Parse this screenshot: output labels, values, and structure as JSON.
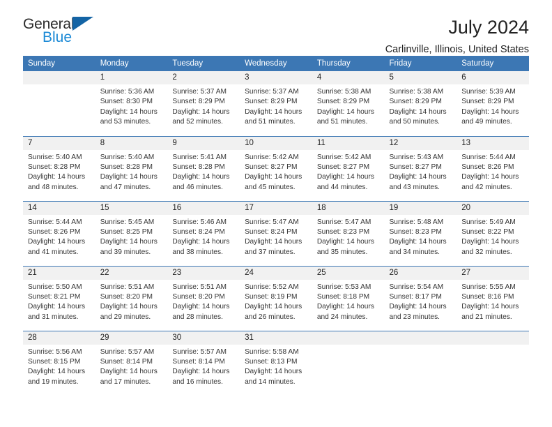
{
  "logo": {
    "word1": "General",
    "word2": "Blue",
    "triangle_color": "#1464a5",
    "blue_color": "#1c8ad6"
  },
  "header": {
    "month_title": "July 2024",
    "location": "Carlinville, Illinois, United States"
  },
  "colors": {
    "header_blue": "#3c77b4",
    "daynum_band": "#f1f1f1",
    "text": "#333333"
  },
  "calendar": {
    "weekday_headers": [
      "Sunday",
      "Monday",
      "Tuesday",
      "Wednesday",
      "Thursday",
      "Friday",
      "Saturday"
    ],
    "labels": {
      "sunrise": "Sunrise:",
      "sunset": "Sunset:",
      "daylight": "Daylight:"
    },
    "weeks": [
      [
        {
          "day": ""
        },
        {
          "day": "1",
          "sunrise": "Sunrise: 5:36 AM",
          "sunset": "Sunset: 8:30 PM",
          "daylight1": "Daylight: 14 hours",
          "daylight2": "and 53 minutes."
        },
        {
          "day": "2",
          "sunrise": "Sunrise: 5:37 AM",
          "sunset": "Sunset: 8:29 PM",
          "daylight1": "Daylight: 14 hours",
          "daylight2": "and 52 minutes."
        },
        {
          "day": "3",
          "sunrise": "Sunrise: 5:37 AM",
          "sunset": "Sunset: 8:29 PM",
          "daylight1": "Daylight: 14 hours",
          "daylight2": "and 51 minutes."
        },
        {
          "day": "4",
          "sunrise": "Sunrise: 5:38 AM",
          "sunset": "Sunset: 8:29 PM",
          "daylight1": "Daylight: 14 hours",
          "daylight2": "and 51 minutes."
        },
        {
          "day": "5",
          "sunrise": "Sunrise: 5:38 AM",
          "sunset": "Sunset: 8:29 PM",
          "daylight1": "Daylight: 14 hours",
          "daylight2": "and 50 minutes."
        },
        {
          "day": "6",
          "sunrise": "Sunrise: 5:39 AM",
          "sunset": "Sunset: 8:29 PM",
          "daylight1": "Daylight: 14 hours",
          "daylight2": "and 49 minutes."
        }
      ],
      [
        {
          "day": "7",
          "sunrise": "Sunrise: 5:40 AM",
          "sunset": "Sunset: 8:28 PM",
          "daylight1": "Daylight: 14 hours",
          "daylight2": "and 48 minutes."
        },
        {
          "day": "8",
          "sunrise": "Sunrise: 5:40 AM",
          "sunset": "Sunset: 8:28 PM",
          "daylight1": "Daylight: 14 hours",
          "daylight2": "and 47 minutes."
        },
        {
          "day": "9",
          "sunrise": "Sunrise: 5:41 AM",
          "sunset": "Sunset: 8:28 PM",
          "daylight1": "Daylight: 14 hours",
          "daylight2": "and 46 minutes."
        },
        {
          "day": "10",
          "sunrise": "Sunrise: 5:42 AM",
          "sunset": "Sunset: 8:27 PM",
          "daylight1": "Daylight: 14 hours",
          "daylight2": "and 45 minutes."
        },
        {
          "day": "11",
          "sunrise": "Sunrise: 5:42 AM",
          "sunset": "Sunset: 8:27 PM",
          "daylight1": "Daylight: 14 hours",
          "daylight2": "and 44 minutes."
        },
        {
          "day": "12",
          "sunrise": "Sunrise: 5:43 AM",
          "sunset": "Sunset: 8:27 PM",
          "daylight1": "Daylight: 14 hours",
          "daylight2": "and 43 minutes."
        },
        {
          "day": "13",
          "sunrise": "Sunrise: 5:44 AM",
          "sunset": "Sunset: 8:26 PM",
          "daylight1": "Daylight: 14 hours",
          "daylight2": "and 42 minutes."
        }
      ],
      [
        {
          "day": "14",
          "sunrise": "Sunrise: 5:44 AM",
          "sunset": "Sunset: 8:26 PM",
          "daylight1": "Daylight: 14 hours",
          "daylight2": "and 41 minutes."
        },
        {
          "day": "15",
          "sunrise": "Sunrise: 5:45 AM",
          "sunset": "Sunset: 8:25 PM",
          "daylight1": "Daylight: 14 hours",
          "daylight2": "and 39 minutes."
        },
        {
          "day": "16",
          "sunrise": "Sunrise: 5:46 AM",
          "sunset": "Sunset: 8:24 PM",
          "daylight1": "Daylight: 14 hours",
          "daylight2": "and 38 minutes."
        },
        {
          "day": "17",
          "sunrise": "Sunrise: 5:47 AM",
          "sunset": "Sunset: 8:24 PM",
          "daylight1": "Daylight: 14 hours",
          "daylight2": "and 37 minutes."
        },
        {
          "day": "18",
          "sunrise": "Sunrise: 5:47 AM",
          "sunset": "Sunset: 8:23 PM",
          "daylight1": "Daylight: 14 hours",
          "daylight2": "and 35 minutes."
        },
        {
          "day": "19",
          "sunrise": "Sunrise: 5:48 AM",
          "sunset": "Sunset: 8:23 PM",
          "daylight1": "Daylight: 14 hours",
          "daylight2": "and 34 minutes."
        },
        {
          "day": "20",
          "sunrise": "Sunrise: 5:49 AM",
          "sunset": "Sunset: 8:22 PM",
          "daylight1": "Daylight: 14 hours",
          "daylight2": "and 32 minutes."
        }
      ],
      [
        {
          "day": "21",
          "sunrise": "Sunrise: 5:50 AM",
          "sunset": "Sunset: 8:21 PM",
          "daylight1": "Daylight: 14 hours",
          "daylight2": "and 31 minutes."
        },
        {
          "day": "22",
          "sunrise": "Sunrise: 5:51 AM",
          "sunset": "Sunset: 8:20 PM",
          "daylight1": "Daylight: 14 hours",
          "daylight2": "and 29 minutes."
        },
        {
          "day": "23",
          "sunrise": "Sunrise: 5:51 AM",
          "sunset": "Sunset: 8:20 PM",
          "daylight1": "Daylight: 14 hours",
          "daylight2": "and 28 minutes."
        },
        {
          "day": "24",
          "sunrise": "Sunrise: 5:52 AM",
          "sunset": "Sunset: 8:19 PM",
          "daylight1": "Daylight: 14 hours",
          "daylight2": "and 26 minutes."
        },
        {
          "day": "25",
          "sunrise": "Sunrise: 5:53 AM",
          "sunset": "Sunset: 8:18 PM",
          "daylight1": "Daylight: 14 hours",
          "daylight2": "and 24 minutes."
        },
        {
          "day": "26",
          "sunrise": "Sunrise: 5:54 AM",
          "sunset": "Sunset: 8:17 PM",
          "daylight1": "Daylight: 14 hours",
          "daylight2": "and 23 minutes."
        },
        {
          "day": "27",
          "sunrise": "Sunrise: 5:55 AM",
          "sunset": "Sunset: 8:16 PM",
          "daylight1": "Daylight: 14 hours",
          "daylight2": "and 21 minutes."
        }
      ],
      [
        {
          "day": "28",
          "sunrise": "Sunrise: 5:56 AM",
          "sunset": "Sunset: 8:15 PM",
          "daylight1": "Daylight: 14 hours",
          "daylight2": "and 19 minutes."
        },
        {
          "day": "29",
          "sunrise": "Sunrise: 5:57 AM",
          "sunset": "Sunset: 8:14 PM",
          "daylight1": "Daylight: 14 hours",
          "daylight2": "and 17 minutes."
        },
        {
          "day": "30",
          "sunrise": "Sunrise: 5:57 AM",
          "sunset": "Sunset: 8:14 PM",
          "daylight1": "Daylight: 14 hours",
          "daylight2": "and 16 minutes."
        },
        {
          "day": "31",
          "sunrise": "Sunrise: 5:58 AM",
          "sunset": "Sunset: 8:13 PM",
          "daylight1": "Daylight: 14 hours",
          "daylight2": "and 14 minutes."
        },
        {
          "day": ""
        },
        {
          "day": ""
        },
        {
          "day": ""
        }
      ]
    ]
  }
}
